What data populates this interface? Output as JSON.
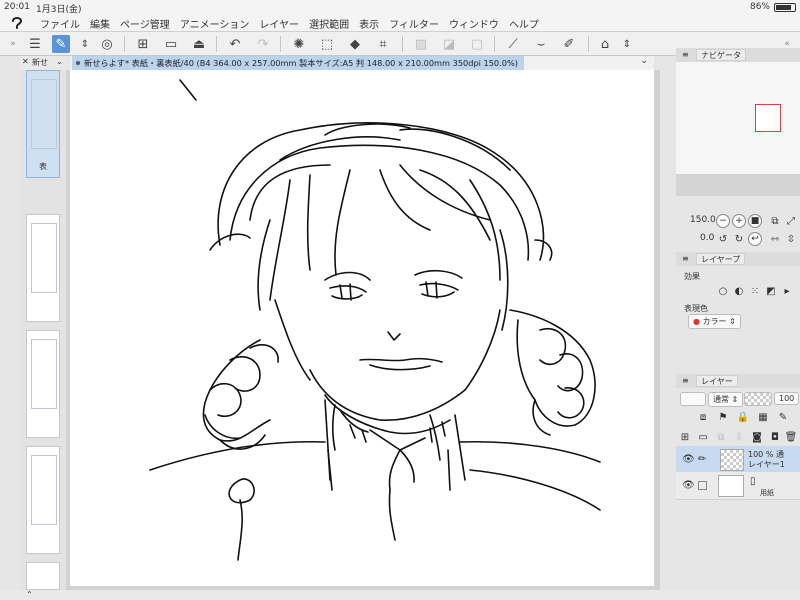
{
  "status": {
    "time": "20:01",
    "date": "1月3日(金)",
    "battery": "86%",
    "battery_level": 0.86
  },
  "menu": [
    "ファイル",
    "編集",
    "ページ管理",
    "アニメーション",
    "レイヤー",
    "選択範囲",
    "表示",
    "フィルター",
    "ウィンドウ",
    "ヘルプ"
  ],
  "left_panel": {
    "tab": "新せ",
    "first_page_label": "表"
  },
  "document": {
    "tab_title": "新せらよす* 表紙・裏表紙/40 (B4 364.00 x 257.00mm 製本サイズ:A5 判 148.00 x 210.00mm 350dpi 150.0%)"
  },
  "navigator": {
    "tab": "ナビゲータ",
    "zoom": "150.0",
    "rotation": "0.0"
  },
  "layer_property": {
    "tab": "レイヤープ",
    "effect_label": "効果",
    "color_label": "表現色",
    "color_value": "カラー"
  },
  "layers": {
    "tab": "レイヤー",
    "blend_mode": "通常",
    "opacity": "100",
    "items": [
      {
        "opacity": "100 %",
        "mode": "通",
        "name": "レイヤー1"
      },
      {
        "name": "用紙"
      }
    ]
  },
  "colors": {
    "accent": "#5a94d6",
    "selection": "#c7daf0",
    "navigator_frame": "#e23c3c"
  }
}
